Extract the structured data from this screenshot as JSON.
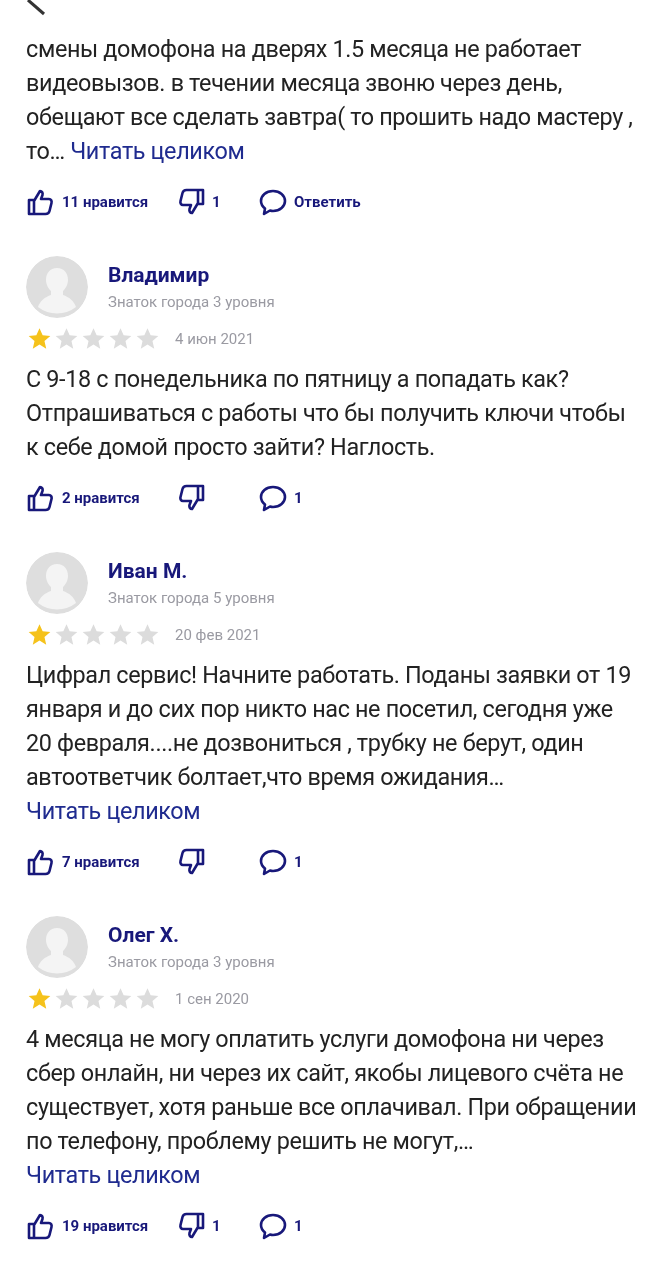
{
  "reviews": [
    {
      "text": "смены домофона на дверях 1.5 месяца не работает видеовызов. в течении месяца звоню через день, обещают все сделать завтра( то прошить надо мастеру , то…",
      "more_link": "Читать целиком",
      "likes": "11 нравится",
      "dislikes": "1",
      "reply": "Ответить"
    },
    {
      "author": "Владимир",
      "level": "Знаток города 3 уровня",
      "stars": 1,
      "date": "4 июн 2021",
      "text": "С 9-18 с понедельника по пятницу а попадать как? Отпрашиваться с работы что бы получить ключи чтобы к себе домой просто зайти? Наглость.",
      "likes": "2 нравится",
      "reply": "1"
    },
    {
      "author": "Иван М.",
      "level": "Знаток города 5 уровня",
      "stars": 1,
      "date": "20 фев 2021",
      "text": "Цифрал сервис! Начните работать. Поданы заявки от 19 января и до сих пор никто нас не посетил, сегодня уже 20 февраля....не дозвониться , трубку не берут, один автоответчик болтает,что время ожидания…",
      "more_link": "Читать целиком",
      "likes": "7 нравится",
      "reply": "1"
    },
    {
      "author": "Олег Х.",
      "level": "Знаток города 3 уровня",
      "stars": 1,
      "date": "1 сен 2020",
      "text": "4 месяца не могу оплатить услуги домофона ни через сбер онлайн, ни через их сайт, якобы лицевого счёта не существует, хотя раньше все оплачивал. При обращении по телефону, проблему решить не могут,…",
      "more_link": "Читать целиком",
      "likes": "19 нравится",
      "dislikes": "1",
      "reply": "1"
    }
  ]
}
